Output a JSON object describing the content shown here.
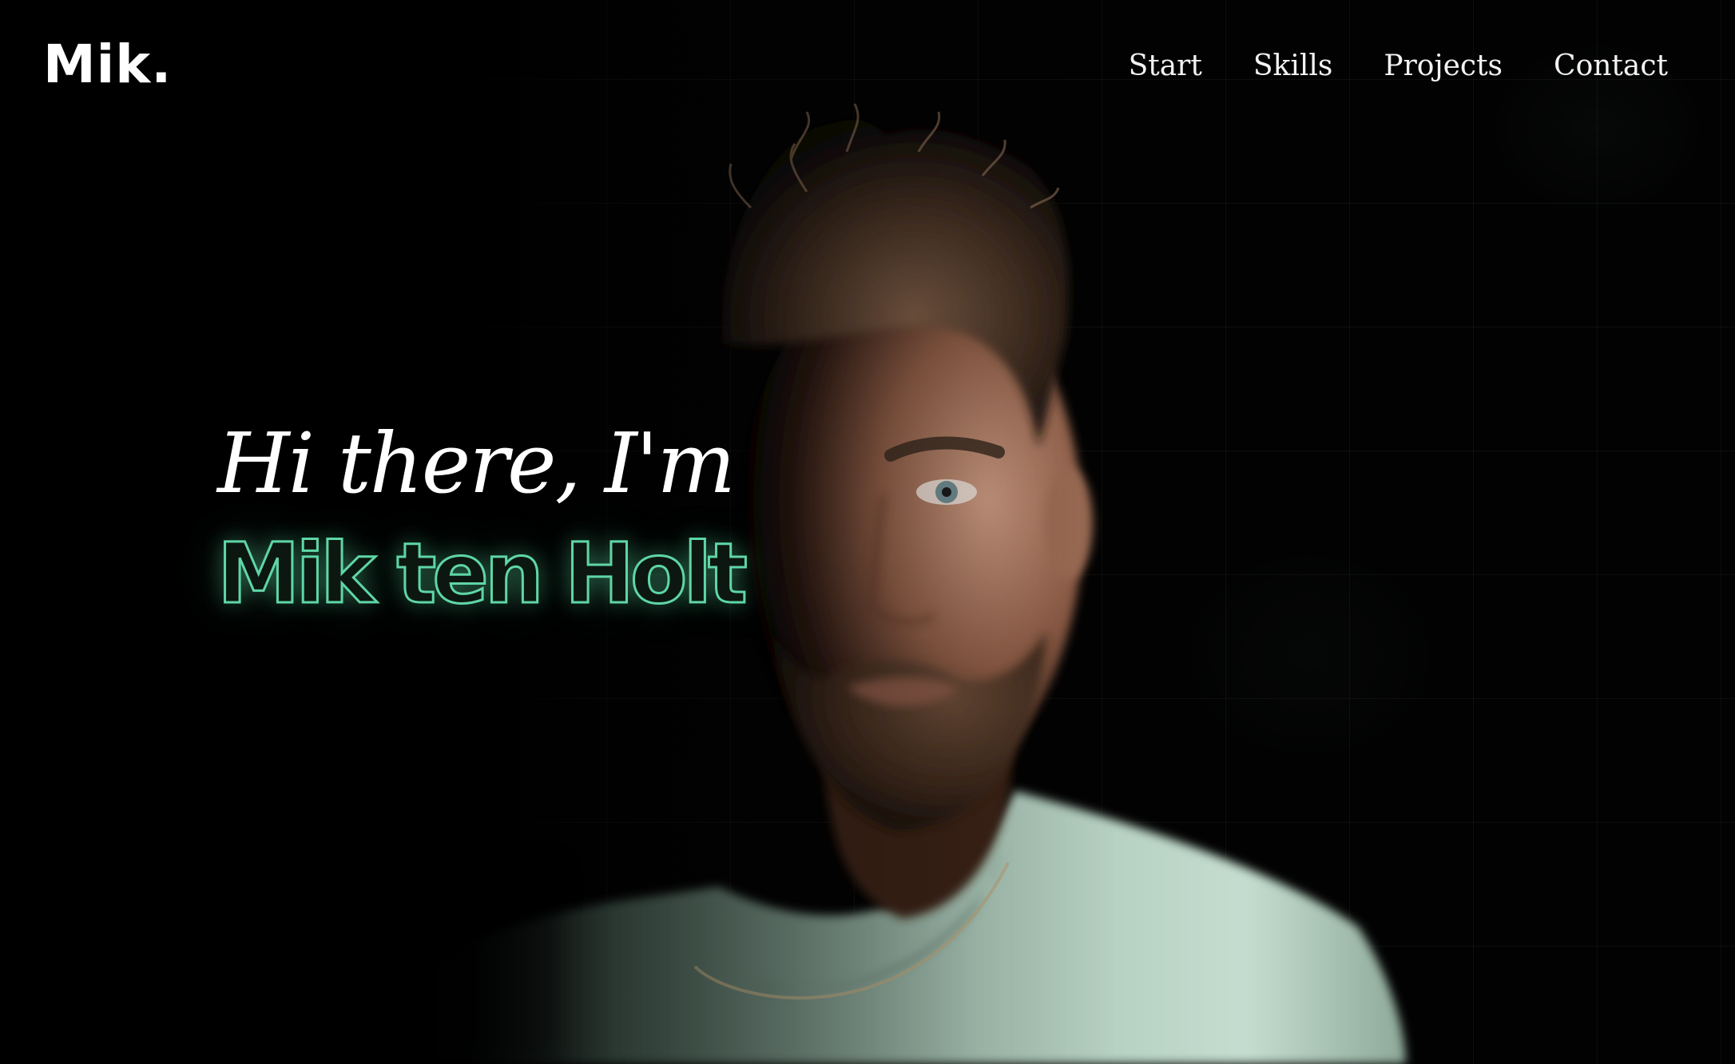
{
  "header": {
    "logo": "Mik.",
    "nav": [
      {
        "label": "Start"
      },
      {
        "label": "Skills"
      },
      {
        "label": "Projects"
      },
      {
        "label": "Contact"
      }
    ]
  },
  "hero": {
    "greeting": "Hi there, I'm",
    "name": "Mik ten Holt"
  },
  "colors": {
    "background": "#000000",
    "accent": "#5fd6a6",
    "text": "#ffffff",
    "shirt": "#b9d6c8"
  }
}
